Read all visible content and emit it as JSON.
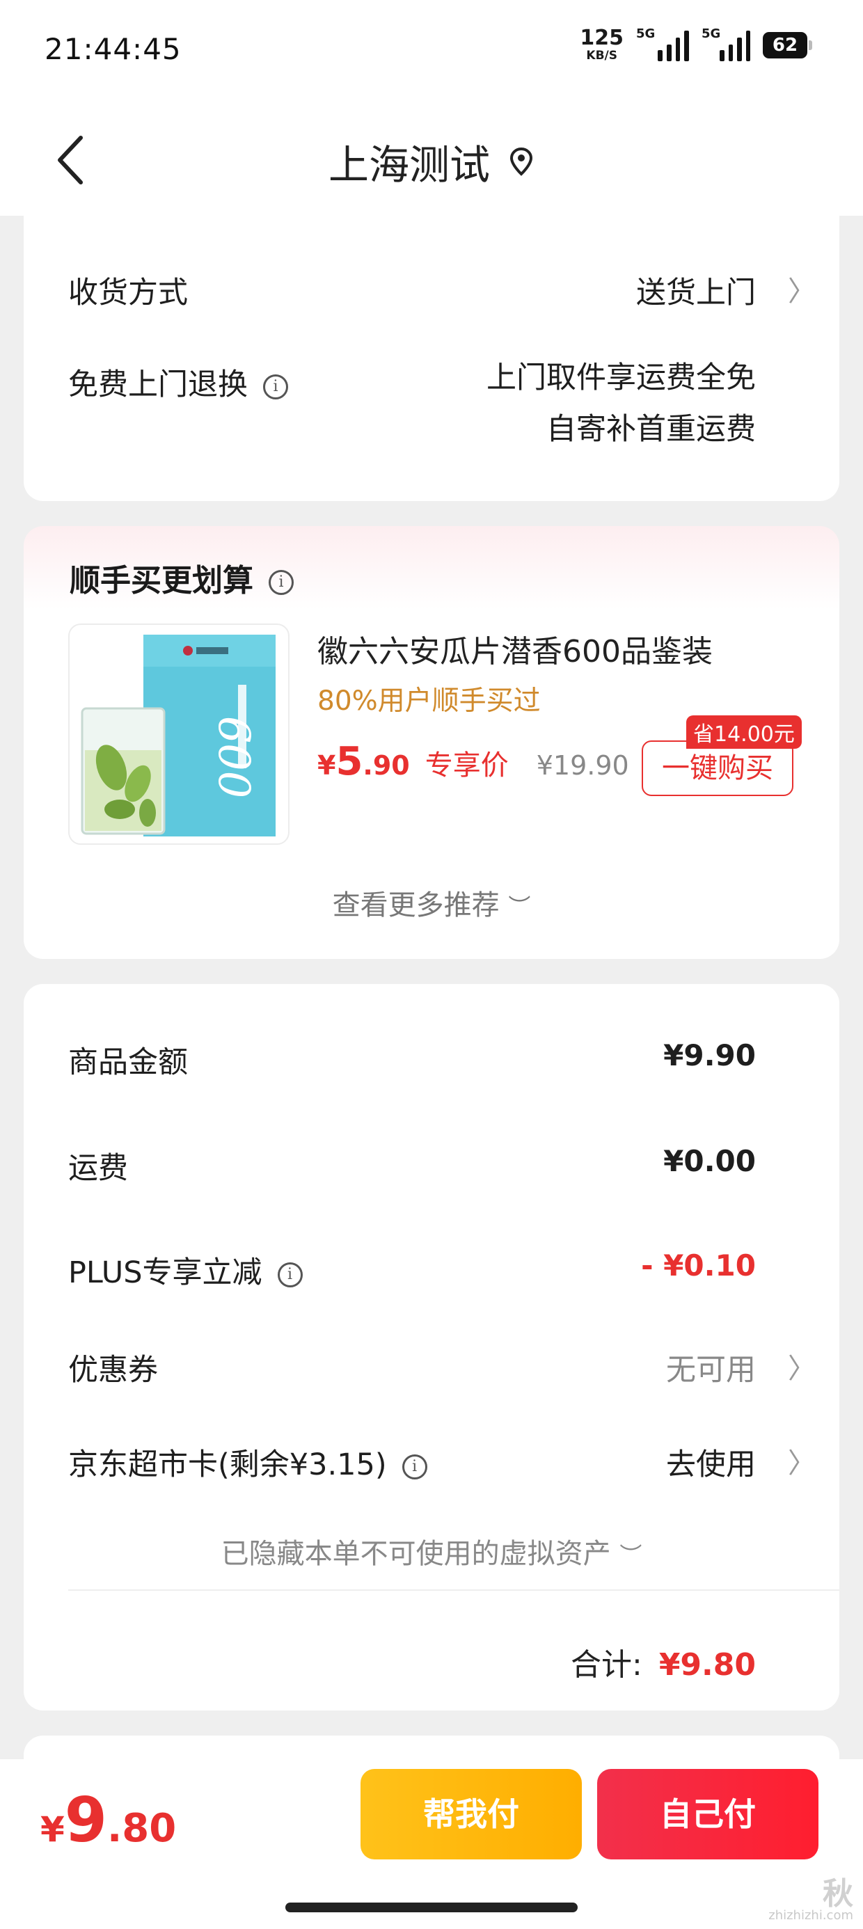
{
  "status_bar": {
    "time": "21:44:45",
    "net_speed_value": "125",
    "net_speed_unit": "KB/S",
    "signal1_label": "5G",
    "signal2_label": "5G",
    "battery": "62"
  },
  "nav": {
    "title": "上海测试",
    "back_icon": "chevron-left-icon",
    "location_icon": "location-pin-icon"
  },
  "delivery": {
    "method_label": "收货方式",
    "method_value": "送货上门",
    "return_label": "免费上门退换",
    "return_value_line1": "上门取件享运费全免",
    "return_value_line2": "自寄补首重运费"
  },
  "recommend": {
    "title": "顺手买更划算",
    "product_name": "徽六六安瓜片潜香600品鉴装",
    "product_tag": "80%用户顺手买过",
    "price_symbol": "¥",
    "price_int": "5",
    "price_dec": ".90",
    "price_label": "专享价",
    "original_price": "¥19.90",
    "save_tag": "省14.00元",
    "buy_button": "一键购买",
    "see_more": "查看更多推荐"
  },
  "summary": {
    "goods_label": "商品金额",
    "goods_value": "¥9.90",
    "shipping_label": "运费",
    "shipping_value": "¥0.00",
    "plus_label": "PLUS专享立减",
    "plus_value": "- ¥0.10",
    "coupon_label": "优惠券",
    "coupon_value": "无可用",
    "card_label": "京东超市卡(剩余¥3.15)",
    "card_value": "去使用",
    "hidden_note": "已隐藏本单不可使用的虚拟资产",
    "total_label": "合计:",
    "total_value": "¥9.80"
  },
  "bottom": {
    "price_symbol": "¥",
    "price_int": "9",
    "price_dec": ".80",
    "help_pay": "帮我付",
    "self_pay": "自己付"
  },
  "watermark": {
    "top": "秋",
    "bottom": "zhizhizhi.com"
  },
  "colors": {
    "accent_red": "#e8302f",
    "tag_orange": "#d08a2c",
    "help_button": "#ffb400",
    "self_button": "#f7263c"
  }
}
